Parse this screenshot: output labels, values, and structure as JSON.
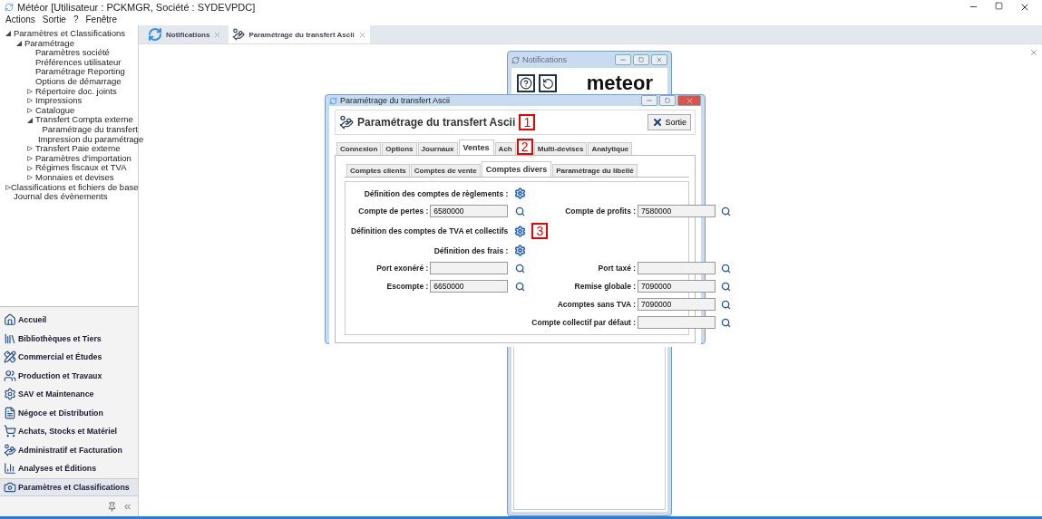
{
  "window": {
    "title": "Météor [Utilisateur : PCKMGR, Société : SYDEVPDC]"
  },
  "menu": [
    "Actions",
    "Sortie",
    "?",
    "Fenêtre"
  ],
  "tree": [
    {
      "label": "Paramètres et Classifications",
      "expanded": true,
      "children": [
        {
          "label": "Paramétrage",
          "expanded": true,
          "children": [
            {
              "label": "Paramètres société"
            },
            {
              "label": "Préférences utilisateur"
            },
            {
              "label": "Paramétrage Reporting"
            },
            {
              "label": "Options de démarrage"
            },
            {
              "label": "Répertoire doc. joints",
              "expanded": false
            },
            {
              "label": "Impressions",
              "expanded": false
            },
            {
              "label": "Catalogue",
              "expanded": false
            },
            {
              "label": "Transfert Compta externe",
              "expanded": true,
              "children": [
                {
                  "label": "Paramétrage du transfert"
                },
                {
                  "label": "Impression du paramétrage"
                }
              ]
            },
            {
              "label": "Transfert Paie externe",
              "expanded": false
            },
            {
              "label": "Paramètres d'importation",
              "expanded": false
            },
            {
              "label": "Régimes fiscaux et TVA",
              "expanded": false
            },
            {
              "label": "Monnaies et devises",
              "expanded": false
            }
          ]
        }
      ]
    },
    {
      "label": "Classifications et fichiers de base",
      "expanded": false
    },
    {
      "label": "Journal des évènements"
    }
  ],
  "nav": [
    {
      "label": "Accueil",
      "selected": false
    },
    {
      "label": "Bibliothèques et Tiers",
      "selected": false
    },
    {
      "label": "Commercial et Études",
      "selected": false
    },
    {
      "label": "Production et Travaux",
      "selected": false
    },
    {
      "label": "SAV et Maintenance",
      "selected": false
    },
    {
      "label": "Négoce et Distribution",
      "selected": false
    },
    {
      "label": "Achats, Stocks et Matériel",
      "selected": false
    },
    {
      "label": "Administratif et Facturation",
      "selected": false
    },
    {
      "label": "Analyses et Éditions",
      "selected": false
    },
    {
      "label": "Paramètres et Classifications",
      "selected": true
    }
  ],
  "doc_tabs": [
    {
      "label": "Notifications",
      "selected": false
    },
    {
      "label": "Paramétrage du transfert Ascii",
      "selected": true
    }
  ],
  "notifications_window": {
    "title": "Notifications",
    "logo": "meteor"
  },
  "dialog": {
    "title": "Paramétrage du transfert Ascii",
    "header": "Paramétrage du transfert Ascii",
    "header_callout": "1",
    "exit_button": "Sortie",
    "tabs": [
      {
        "label": "Connexion",
        "selected": false
      },
      {
        "label": "Options",
        "selected": false
      },
      {
        "label": "Journaux",
        "selected": false
      },
      {
        "label": "Ventes",
        "selected": true
      },
      {
        "label": "Ach",
        "selected": false,
        "callout": "2"
      },
      {
        "label": "Multi-devises",
        "selected": false
      },
      {
        "label": "Analytique",
        "selected": false
      }
    ],
    "subtabs": [
      {
        "label": "Comptes clients",
        "selected": false
      },
      {
        "label": "Comptes de vente",
        "selected": false
      },
      {
        "label": "Comptes divers",
        "selected": true
      },
      {
        "label": "Paramétrage du libellé",
        "selected": false
      }
    ],
    "rows": [
      {
        "kind": "action",
        "label": "Définition des comptes de règlements :"
      },
      {
        "kind": "fields",
        "left": {
          "label": "Compte de pertes :",
          "value": "6580000"
        },
        "right": {
          "label": "Compte de profits :",
          "value": "7580000"
        }
      },
      {
        "kind": "action",
        "label": "Définition des comptes de TVA et collectifs",
        "callout": "3"
      },
      {
        "kind": "action",
        "label": "Définition des frais :"
      },
      {
        "kind": "fields",
        "left": {
          "label": "Port exonéré :"
        },
        "right": {
          "label": "Port taxé :"
        }
      },
      {
        "kind": "fields",
        "left": {
          "label": "Escompte :",
          "value": "6650000"
        },
        "right": {
          "label": "Remise globale :",
          "value": "7090000"
        }
      },
      {
        "kind": "fields",
        "right": {
          "label": "Acomptes sans TVA :",
          "value": "7090000"
        }
      },
      {
        "kind": "fields",
        "right": {
          "label": "Compte collectif par défaut :"
        }
      }
    ]
  }
}
